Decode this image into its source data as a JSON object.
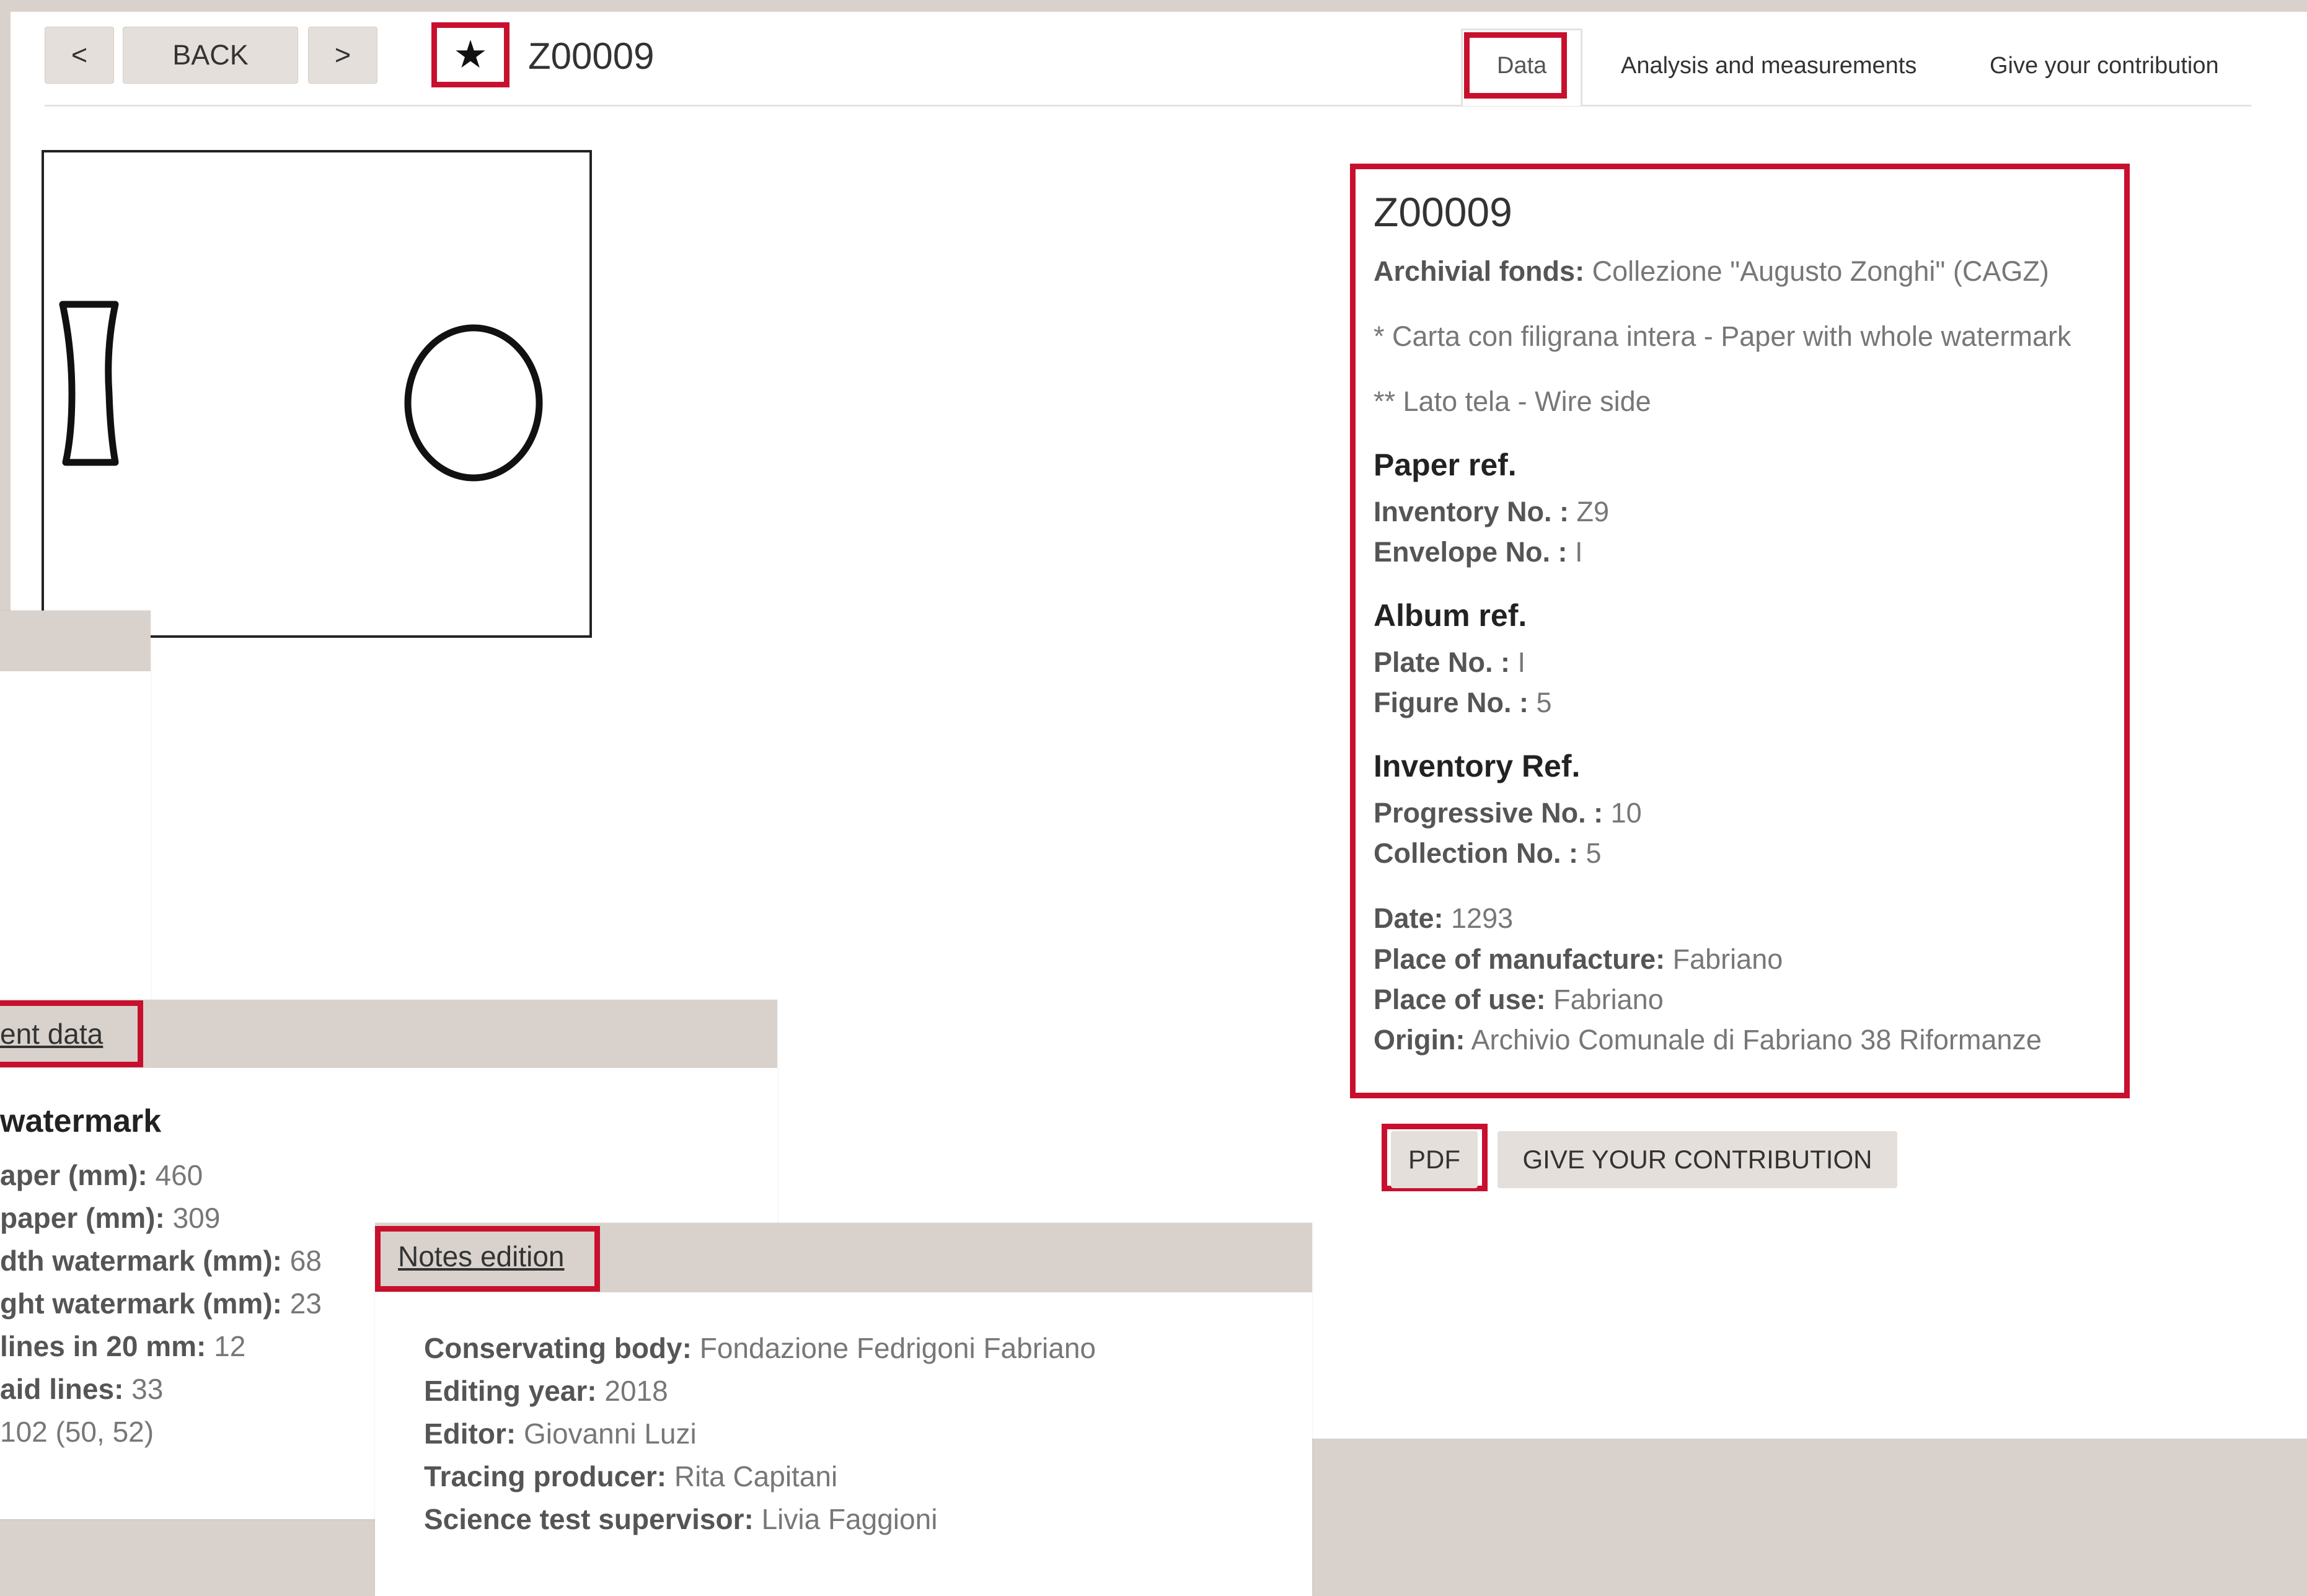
{
  "colors": {
    "highlight": "#c8102e",
    "background": "#d9d2cc",
    "button": "#e4dfda"
  },
  "nav": {
    "prev_label": "<",
    "back_label": "BACK",
    "next_label": ">",
    "favorite_icon": "star-icon",
    "favorite_glyph": "★"
  },
  "record": {
    "id": "Z00009"
  },
  "tabs": [
    {
      "label": "Data"
    },
    {
      "label": "Analysis and measurements"
    },
    {
      "label": "Give your contribution"
    }
  ],
  "info": {
    "title": "Z00009",
    "fonds_label": "Archivial fonds:",
    "fonds_value": " Collezione \"Augusto Zonghi\" (CAGZ)",
    "note1": "* Carta con filigrana intera - Paper with whole watermark",
    "note2": "** Lato tela - Wire side",
    "paper_ref_heading": "Paper ref.",
    "inventory_label": "Inventory No. :",
    "inventory_value": " Z9",
    "envelope_label": "Envelope No. :",
    "envelope_value": " I",
    "album_ref_heading": "Album ref.",
    "plate_label": "Plate No. :",
    "plate_value": " I",
    "figure_label": "Figure No. :",
    "figure_value": " 5",
    "inventory_ref_heading": "Inventory Ref.",
    "progressive_label": "Progressive No. :",
    "progressive_value": " 10",
    "collection_label": "Collection No. :",
    "collection_value": " 5",
    "date_label": "Date:",
    "date_value": " 1293",
    "manufacture_label": "Place of manufacture:",
    "manufacture_value": " Fabriano",
    "use_label": "Place of use:",
    "use_value": " Fabriano",
    "origin_label": "Origin:",
    "origin_value": " Archivio Comunale di Fabriano 38 Riformanze"
  },
  "actions": {
    "pdf_label": "PDF",
    "contribute_label": "GIVE YOUR CONTRIBUTION"
  },
  "measurements": {
    "tab_label": "ent data",
    "heading": "watermark",
    "rows": [
      {
        "label": "aper (mm):",
        "value": " 460"
      },
      {
        "label": "paper (mm):",
        "value": " 309"
      },
      {
        "label": "dth watermark (mm):",
        "value": " 68"
      },
      {
        "label": "ght watermark (mm):",
        "value": " 23"
      },
      {
        "label": " lines in 20 mm:",
        "value": " 12"
      },
      {
        "label": "aid lines:",
        "value": " 33"
      },
      {
        "label": "",
        "value": " 102 (50, 52)"
      }
    ]
  },
  "notes": {
    "tab_label": "Notes edition",
    "rows": [
      {
        "label": "Conservating body:",
        "value": " Fondazione Fedrigoni Fabriano"
      },
      {
        "label": "Editing year:",
        "value": " 2018"
      },
      {
        "label": "Editor:",
        "value": " Giovanni Luzi"
      },
      {
        "label": "Tracing producer:",
        "value": " Rita Capitani"
      },
      {
        "label": "Science test supervisor:",
        "value": " Livia Faggioni"
      }
    ]
  }
}
